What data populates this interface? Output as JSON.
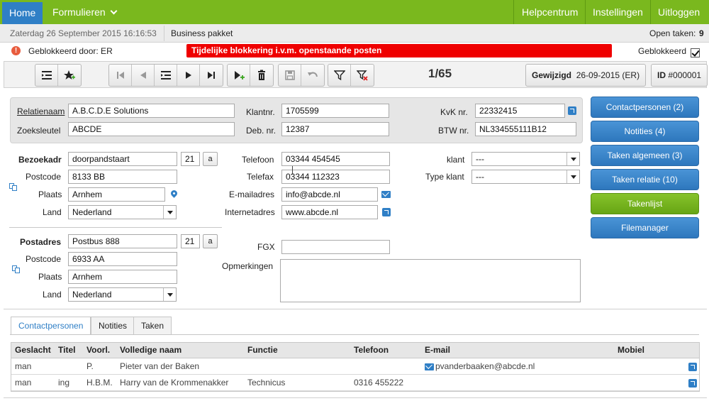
{
  "nav": {
    "home": "Home",
    "formulieren": "Formulieren",
    "help": "Helpcentrum",
    "settings": "Instellingen",
    "logout": "Uitloggen"
  },
  "info": {
    "datetime": "Zaterdag 26 September 2015 16:16:53",
    "package": "Business pakket",
    "open_tasks_label": "Open taken:",
    "open_tasks_count": "9"
  },
  "block": {
    "blocked_by": "Geblokkeerd door: ER",
    "message": "Tijdelijke blokkering i.v.m. openstaande posten",
    "blocked_label": "Geblokkeerd",
    "blocked_checked": true
  },
  "toolbar": {
    "counter": "1/65",
    "modified_label": "Gewijzigd",
    "modified_value": "26-09-2015 (ER)",
    "id_label": "ID",
    "id_value": "#000001"
  },
  "relation": {
    "name_label": "Relatienaam",
    "name_value": "A.B.C.D.E Solutions",
    "search_label": "Zoeksleutel",
    "search_value": "ABCDE",
    "clientnr_label": "Klantnr.",
    "clientnr_value": "1705599",
    "debnr_label": "Deb. nr.",
    "debnr_value": "12387",
    "kvk_label": "KvK nr.",
    "kvk_value": "22332415",
    "btw_label": "BTW nr.",
    "btw_value": "NL334555111B12"
  },
  "visit": {
    "title": "Bezoekadr",
    "street": "doorpandstaart",
    "number": "21",
    "suffix": "a",
    "postcode_label": "Postcode",
    "postcode": "8133 BB",
    "city_label": "Plaats",
    "city": "Arnhem",
    "country_label": "Land",
    "country": "Nederland"
  },
  "postal": {
    "title": "Postadres",
    "street": "Postbus 888",
    "number": "21",
    "suffix": "a",
    "postcode_label": "Postcode",
    "postcode": "6933 AA",
    "city_label": "Plaats",
    "city": "Arnhem",
    "country_label": "Land",
    "country": "Nederland"
  },
  "contact": {
    "phone_label": "Telefoon",
    "phone": "03344 454545",
    "fax_label": "Telefax",
    "fax": "03344 112323",
    "email_label": "E-mailadres",
    "email": "info@abcde.nl",
    "web_label": "Internetadres",
    "web": "www.abcde.nl",
    "fgx_label": "FGX",
    "fgx": "",
    "remarks_label": "Opmerkingen",
    "klant_label": "klant",
    "klant_value": "---",
    "type_label": "Type klant",
    "type_value": "---"
  },
  "side_buttons": [
    "Contactpersonen (2)",
    "Notities (4)",
    "Taken algemeen (3)",
    "Taken relatie (10)",
    "Takenlijst",
    "Filemanager"
  ],
  "tabs": [
    "Contactpersonen",
    "Notities",
    "Taken"
  ],
  "table": {
    "headers": [
      "Geslacht",
      "Titel",
      "Voorl.",
      "Volledige naam",
      "Functie",
      "Telefoon",
      "E-mail",
      "Mobiel"
    ],
    "rows": [
      [
        "man",
        "",
        "P.",
        "Pieter van der Baken",
        "",
        "",
        "pvanderbaaken@abcde.nl",
        ""
      ],
      [
        "man",
        "ing",
        "H.B.M.",
        "Harry van de Krommenakker",
        "Technicus",
        "0316 455222",
        "",
        ""
      ]
    ]
  },
  "colors": {
    "nav_green": "#7ab81e",
    "home_blue": "#2f7fc6",
    "alert_red": "#ef0000",
    "button_blue": "#2e77bd",
    "button_green": "#67a514"
  }
}
